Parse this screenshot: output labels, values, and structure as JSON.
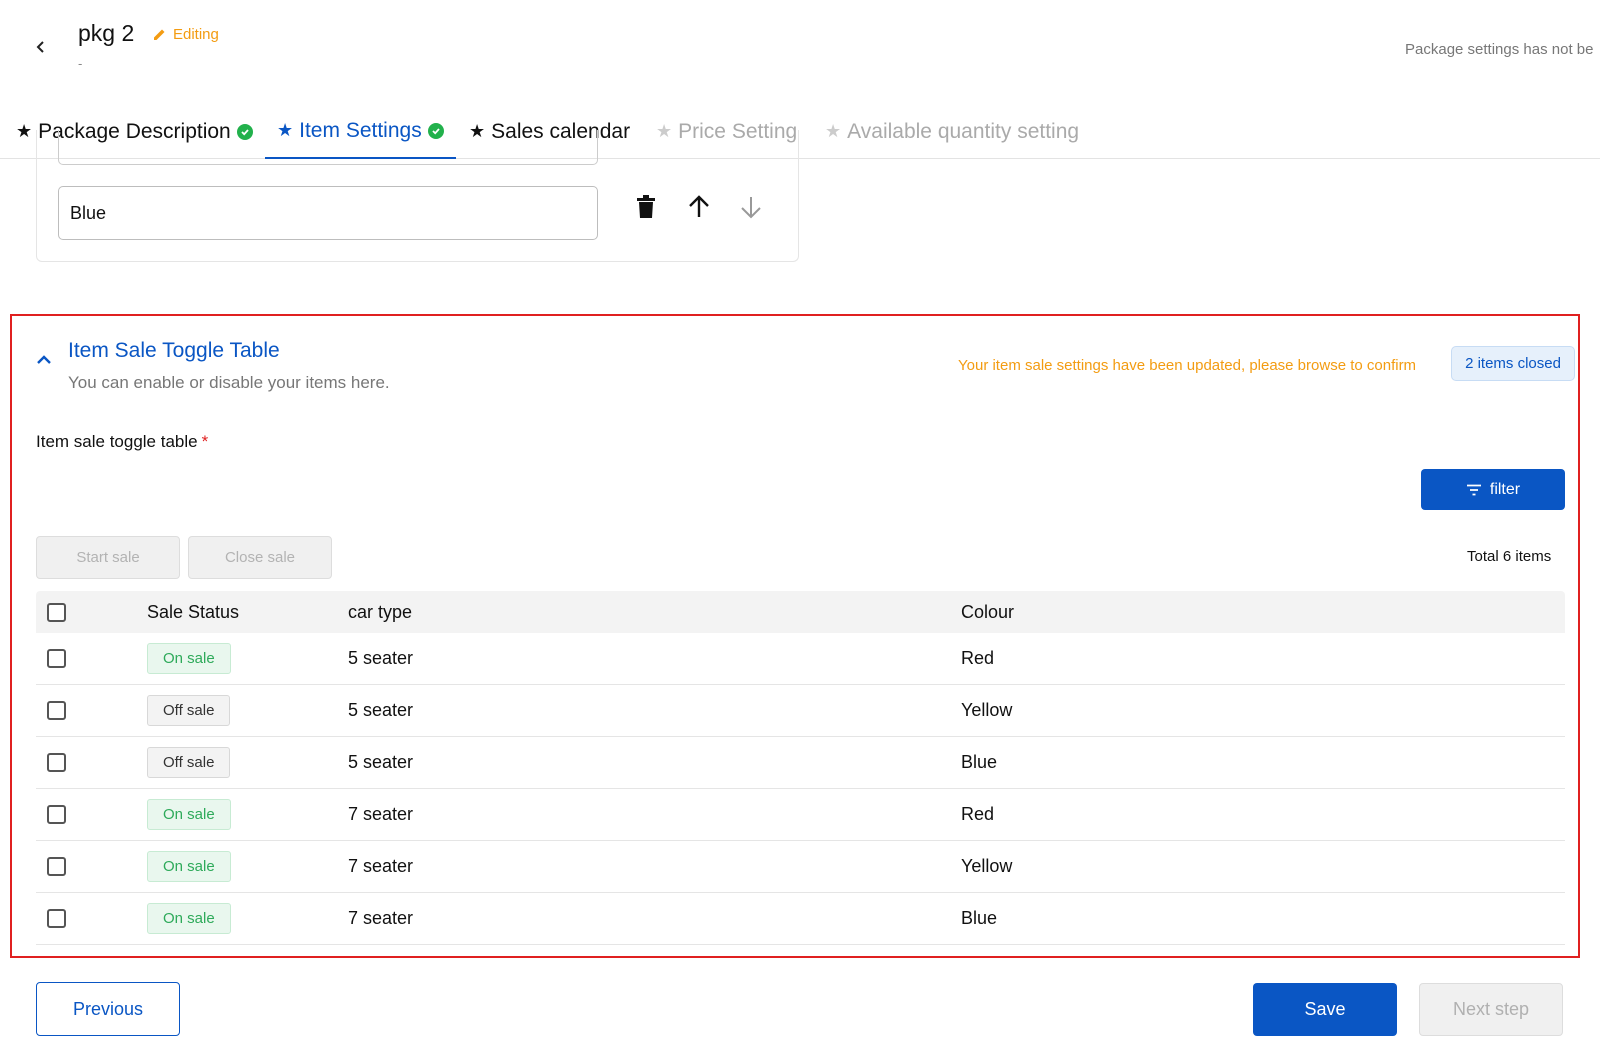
{
  "header": {
    "title": "pkg 2",
    "editing_label": "Editing",
    "subtitle": "-",
    "status_text": "Package settings has not be"
  },
  "tabs": [
    {
      "label": "Package Description",
      "state": "done"
    },
    {
      "label": "Item Settings",
      "state": "active"
    },
    {
      "label": "Sales calendar",
      "state": "normal"
    },
    {
      "label": "Price Setting",
      "state": "disabled"
    },
    {
      "label": "Available quantity setting",
      "state": "disabled"
    }
  ],
  "option_editor": {
    "value": "Blue"
  },
  "section": {
    "title": "Item Sale Toggle Table",
    "description": "You can enable or disable your items here.",
    "notice": "Your item sale settings have been updated, please browse to confirm",
    "closed_badge": "2 items closed",
    "field_label": "Item sale toggle table",
    "required_mark": "*",
    "filter_label": "filter",
    "start_sale_label": "Start sale",
    "close_sale_label": "Close sale",
    "total_text": "Total 6 items",
    "columns": [
      "Sale Status",
      "car type",
      "Colour"
    ],
    "rows": [
      {
        "status": "On sale",
        "on": true,
        "car_type": "5 seater",
        "colour": "Red"
      },
      {
        "status": "Off sale",
        "on": false,
        "car_type": "5 seater",
        "colour": "Yellow"
      },
      {
        "status": "Off sale",
        "on": false,
        "car_type": "5 seater",
        "colour": "Blue"
      },
      {
        "status": "On sale",
        "on": true,
        "car_type": "7 seater",
        "colour": "Red"
      },
      {
        "status": "On sale",
        "on": true,
        "car_type": "7 seater",
        "colour": "Yellow"
      },
      {
        "status": "On sale",
        "on": true,
        "car_type": "7 seater",
        "colour": "Blue"
      }
    ]
  },
  "footer": {
    "previous_label": "Previous",
    "save_label": "Save",
    "next_label": "Next step"
  },
  "colors": {
    "primary": "#0a56c4",
    "warning": "#f39c12",
    "success": "#22b14c",
    "highlight_border": "#e02020"
  }
}
